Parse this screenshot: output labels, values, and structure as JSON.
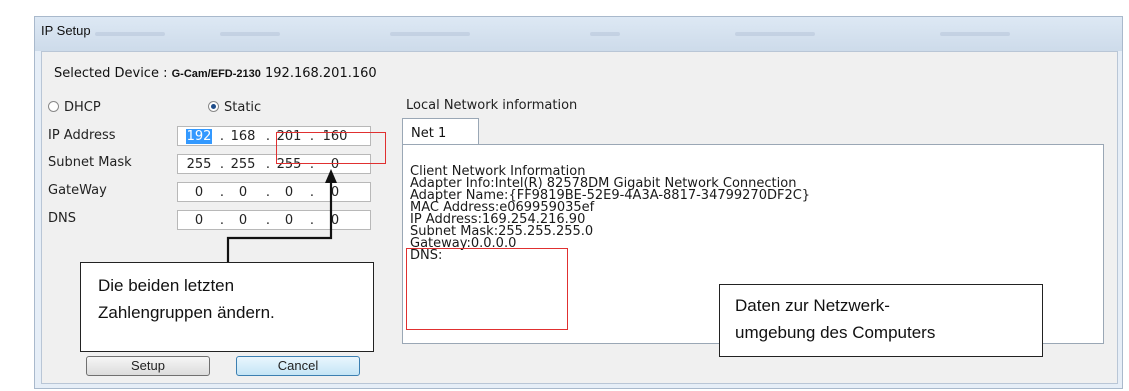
{
  "window": {
    "title": "IP Setup"
  },
  "selected_device": {
    "label": "Selected Device :",
    "name": "G-Cam/EFD-2130",
    "ip": "192.168.201.160"
  },
  "mode": {
    "dhcp_label": "DHCP",
    "static_label": "Static",
    "selected": "Static"
  },
  "fields": {
    "ip_label": "IP Address",
    "ip": [
      "192",
      "168",
      "201",
      "160"
    ],
    "mask_label": "Subnet Mask",
    "mask": [
      "255",
      "255",
      "255",
      "0"
    ],
    "gateway_label": "GateWay",
    "gateway": [
      "0",
      "0",
      "0",
      "0"
    ],
    "dns_label": "DNS",
    "dns": [
      "0",
      "0",
      "0",
      "0"
    ],
    "dot": "."
  },
  "local_network": {
    "heading": "Local Network information",
    "tab": "Net 1",
    "lines": [
      "Client Network Information",
      "Adapter Info:Intel(R) 82578DM Gigabit Network Connection",
      "Adapter Name:{FF9819BE-52E9-4A3A-8817-34799270DF2C}",
      "MAC Address:e069959035ef",
      "IP Address:169.254.216.90",
      "Subnet Mask:255.255.255.0",
      "Gateway:0.0.0.0",
      "DNS:"
    ]
  },
  "buttons": {
    "setup": "Setup",
    "cancel": "Cancel"
  },
  "annotations": {
    "left": [
      "Die beiden letzten",
      "Zahlengruppen ändern."
    ],
    "right": [
      "Daten zur Netzwerk-",
      "umgebung des Computers"
    ]
  },
  "colors": {
    "highlight": "#3399ff",
    "annotation_red": "#e03030"
  }
}
